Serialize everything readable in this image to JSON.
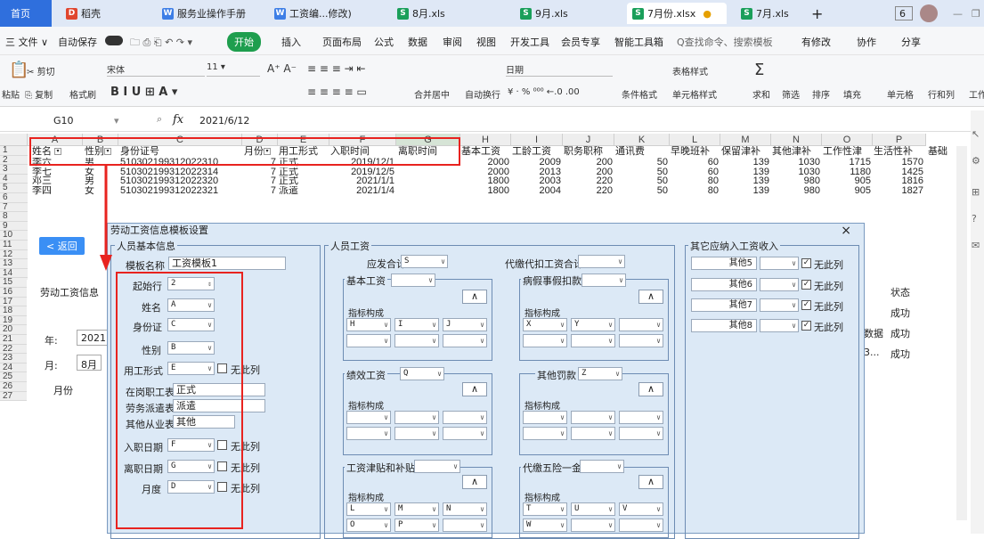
{
  "tabs": [
    {
      "label": "首页",
      "type": "home"
    },
    {
      "label": "稻壳",
      "icon": "docer-icon"
    },
    {
      "label": "服务业操作手册",
      "icon": "w"
    },
    {
      "label": "工资编...修改)",
      "icon": "w"
    },
    {
      "label": "8月.xls",
      "icon": "s"
    },
    {
      "label": "9月.xls",
      "icon": "s"
    },
    {
      "label": "7月份.xlsx",
      "icon": "s",
      "active": true
    },
    {
      "label": "7月.xls",
      "icon": "s"
    },
    {
      "label": "+"
    }
  ],
  "tab_badge": "6",
  "menu": {
    "file": "三 文件 ∨",
    "autosave": "自动保存",
    "start": "开始",
    "items": [
      "插入",
      "页面布局",
      "公式",
      "数据",
      "审阅",
      "视图",
      "开发工具",
      "会员专享",
      "智能工具箱"
    ],
    "search": "Q查找命令、搜索模板",
    "right": [
      "有修改",
      "协作",
      "分享"
    ]
  },
  "ribbon": {
    "paste": "粘贴",
    "cut": "剪切",
    "copy": "复制",
    "format_painter": "格式刷",
    "font": "宋体",
    "size": "11",
    "merge": "合并居中",
    "wrap": "自动换行",
    "number_format": "日期",
    "cond": "条件格式",
    "table_style": "表格样式",
    "cell_style": "单元格样式",
    "sum": "求和",
    "filter": "筛选",
    "sort": "排序",
    "fill": "填充",
    "cell": "单元格",
    "rowcol": "行和列",
    "work": "工作"
  },
  "formula_bar": {
    "cell_ref": "G10",
    "fx": "fx",
    "value": "2021/6/12"
  },
  "columns": [
    "A",
    "B",
    "C",
    "D",
    "E",
    "F",
    "G",
    "H",
    "I",
    "J",
    "K",
    "L",
    "M",
    "N",
    "O",
    "P"
  ],
  "headers": [
    "姓名",
    "性别",
    "身份证号",
    "月份",
    "用工形式",
    "入职时间",
    "离职时间",
    "基本工资",
    "工龄工资",
    "职务职称",
    "通讯费",
    "早晚班补",
    "保留津补",
    "其他津补",
    "工作性津",
    "生活性补",
    "基础"
  ],
  "rows": [
    [
      "李六",
      "男",
      "510302199312022310",
      "7",
      "正式",
      "2019/12/1",
      "",
      "2000",
      "2009",
      "200",
      "50",
      "60",
      "139",
      "1030",
      "1715",
      "1570"
    ],
    [
      "李七",
      "女",
      "510302199312022314",
      "7",
      "正式",
      "2019/12/5",
      "",
      "2000",
      "2013",
      "200",
      "50",
      "60",
      "139",
      "1030",
      "1180",
      "1425"
    ],
    [
      "邓三",
      "男",
      "510302199312022320",
      "7",
      "正式",
      "2021/1/1",
      "",
      "1800",
      "2003",
      "220",
      "50",
      "80",
      "139",
      "980",
      "905",
      "1816"
    ],
    [
      "李四",
      "女",
      "510302199312022321",
      "7",
      "派遣",
      "2021/1/4",
      "",
      "1800",
      "2004",
      "220",
      "50",
      "80",
      "139",
      "980",
      "905",
      "1827"
    ]
  ],
  "row_numbers": [
    "1",
    "2",
    "3",
    "4",
    "5",
    "6",
    "7",
    "8",
    "9",
    "10",
    "11",
    "12",
    "13",
    "14",
    "15",
    "16",
    "17",
    "18",
    "19",
    "20",
    "21",
    "22",
    "23",
    "24",
    "25",
    "26",
    "27"
  ],
  "background_panel": {
    "back_btn": "< 返回",
    "title": "劳动工资信息",
    "year_label": "年:",
    "year_value": "2021",
    "month_label": "月:",
    "month_value": "8月",
    "month_col": "月份"
  },
  "right_panel": {
    "status_header": "状态",
    "statuses": [
      "成功",
      "成功",
      "成功"
    ],
    "side_label": "数据",
    "side_label2": "3..."
  },
  "dialog": {
    "title": "劳动工资信息模板设置",
    "basic_group": "人员基本信息",
    "template_name_label": "模板名称",
    "template_name": "工资模板1",
    "start_row_label": "起始行",
    "start_row": "2",
    "fields": [
      {
        "label": "姓名",
        "value": "A"
      },
      {
        "label": "身份证",
        "value": "C"
      },
      {
        "label": "性别",
        "value": "B"
      },
      {
        "label": "用工形式",
        "value": "E",
        "no_col": "无此列"
      }
    ],
    "text_fields": [
      {
        "label": "在岗职工表述",
        "value": "正式"
      },
      {
        "label": "劳务派遣表述",
        "value": "派遣"
      },
      {
        "label": "其他从业表述",
        "value": "其他"
      }
    ],
    "date_fields": [
      {
        "label": "入职日期",
        "value": "F",
        "no_col": "无此列"
      },
      {
        "label": "离职日期",
        "value": "G",
        "no_col": "无此列"
      },
      {
        "label": "月度",
        "value": "D",
        "no_col": "无此列"
      }
    ],
    "wage_group": "人员工资",
    "payable_label": "应发合计",
    "payable_value": "S",
    "withheld_label": "代缴代扣工资合计",
    "basic_wage": "基本工资",
    "sick_leave": "病假事假扣款",
    "indicator": "指标构成",
    "basic_cols": [
      "H",
      "I",
      "J"
    ],
    "sick_cols": [
      "X",
      "Y",
      ""
    ],
    "perf_wage": "绩效工资",
    "perf_value": "Q",
    "other_deduct": "其他罚款",
    "other_deduct_value": "Z",
    "allowance": "工资津贴和补贴",
    "insurance": "代缴五险一金",
    "allow_cols1": [
      "L",
      "M",
      "N"
    ],
    "allow_cols2": [
      "O",
      "P",
      ""
    ],
    "ins_cols1": [
      "T",
      "U",
      "V"
    ],
    "ins_cols2": [
      "W",
      "",
      ""
    ],
    "other_group": "其它应纳入工资收入",
    "others": [
      {
        "label": "其他5",
        "no_col": "无此列"
      },
      {
        "label": "其他6",
        "no_col": "无此列"
      },
      {
        "label": "其他7",
        "no_col": "无此列"
      },
      {
        "label": "其他8",
        "no_col": "无此列"
      }
    ],
    "expand": "∧",
    "close": "×"
  }
}
